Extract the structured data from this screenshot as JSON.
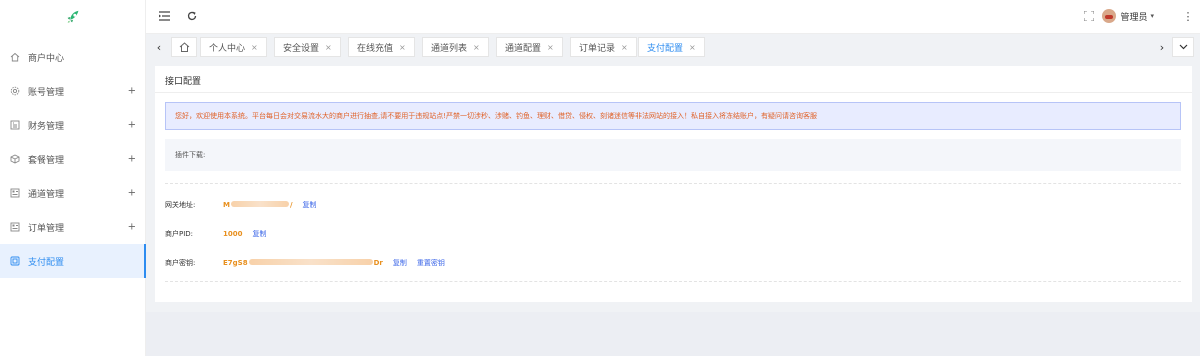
{
  "sidebar": {
    "items": [
      {
        "label": "商户中心",
        "icon": "home-icon",
        "expandable": false,
        "active": false
      },
      {
        "label": "账号管理",
        "icon": "settings-icon",
        "expandable": true,
        "active": false
      },
      {
        "label": "财务管理",
        "icon": "finance-icon",
        "expandable": true,
        "active": false
      },
      {
        "label": "套餐管理",
        "icon": "package-icon",
        "expandable": true,
        "active": false
      },
      {
        "label": "通道管理",
        "icon": "channel-icon",
        "expandable": true,
        "active": false
      },
      {
        "label": "订单管理",
        "icon": "order-icon",
        "expandable": true,
        "active": false
      },
      {
        "label": "支付配置",
        "icon": "payment-icon",
        "expandable": false,
        "active": true
      }
    ],
    "plus_glyph": "+"
  },
  "header": {
    "user_name": "管理员",
    "caret": "▾",
    "more": "⋮"
  },
  "tabs": {
    "items": [
      {
        "label": "个人中心",
        "active": false
      },
      {
        "label": "安全设置",
        "active": false
      },
      {
        "label": "在线充值",
        "active": false
      },
      {
        "label": "通道列表",
        "active": false
      },
      {
        "label": "通道配置",
        "active": false
      },
      {
        "label": "订单记录",
        "active": false
      },
      {
        "label": "支付配置",
        "active": true
      }
    ],
    "close_glyph": "×",
    "prev_glyph": "‹",
    "next_glyph": "›"
  },
  "card": {
    "title": "接口配置",
    "notice": "您好，欢迎使用本系统。平台每日会对交易流水大的商户进行抽查,请不要用于违规站点!严禁一切涉秒、涉赌、钓鱼、理财、借贷、侵权、刻诸迷信等非法网站的接入！私自接入将冻结账户，有疑问请咨询客服",
    "plugin_label": "插件下载:",
    "gateway": {
      "label": "网关地址:",
      "value_start": "M",
      "value_end": "/",
      "copy": "复制"
    },
    "pid": {
      "label": "商户PID:",
      "value": "1000",
      "copy": "复制"
    },
    "key": {
      "label": "商户密钥:",
      "value_start": "E7gS8",
      "value_end": "Dr",
      "copy": "复制",
      "reset": "重置密钥"
    }
  },
  "colors": {
    "accent": "#2d8cf0",
    "warning_text": "#e0632a",
    "value": "#e8901f",
    "link": "#3b66e8"
  }
}
